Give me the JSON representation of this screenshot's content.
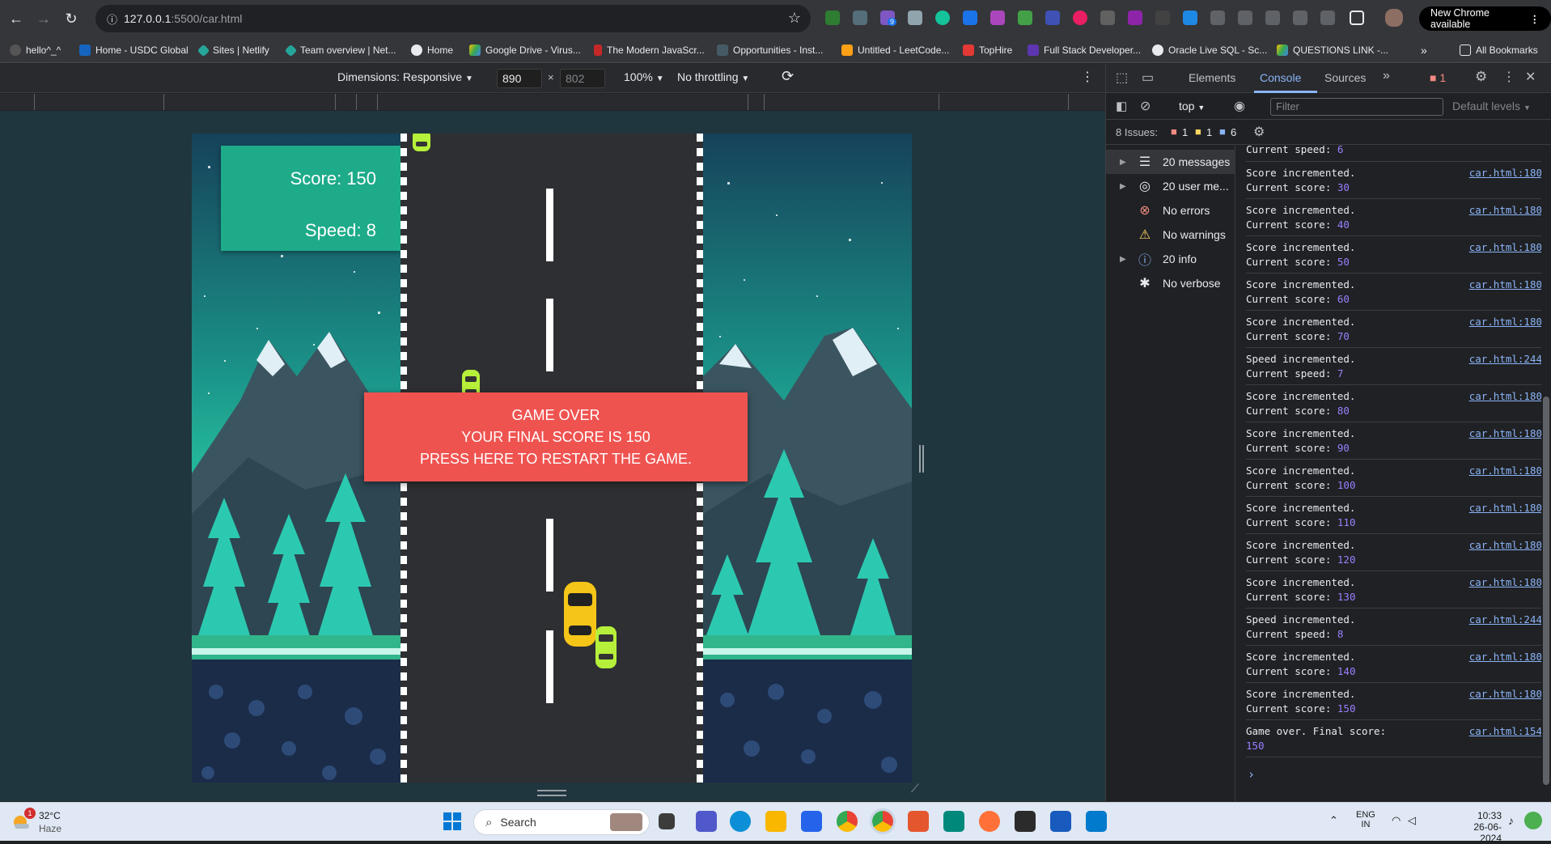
{
  "browser": {
    "url_host": "127.0.0.1",
    "url_path": ":5500/car.html",
    "new_chrome_label": "New Chrome available",
    "bookmarks": [
      "hello^_^",
      "Home - USDC Global",
      "Sites | Netlify",
      "Team overview | Net...",
      "Home",
      "Google Drive - Virus...",
      "The Modern JavaScr...",
      "Opportunities - Inst...",
      "Untitled - LeetCode...",
      "TopHire",
      "Full Stack Developer...",
      "Oracle Live SQL - Sc...",
      "QUESTIONS LINK -..."
    ],
    "all_bookmarks_label": "All Bookmarks",
    "extension_badge": "9"
  },
  "device_toolbar": {
    "dimensions_label": "Dimensions: Responsive",
    "width": "890",
    "height": "802",
    "zoom": "100%",
    "throttling": "No throttling"
  },
  "game": {
    "score_label": "Score: 150",
    "speed_label": "Speed: 8",
    "gameover_line1": "GAME OVER",
    "gameover_line2": "YOUR FINAL SCORE IS 150",
    "gameover_line3": "PRESS HERE TO RESTART THE GAME.",
    "colors": {
      "panel": "#1eab8a",
      "gameover": "#ef5350",
      "player_car": "#f5c518",
      "enemy_car": "#b6f03a"
    }
  },
  "devtools": {
    "tabs": [
      "Elements",
      "Console",
      "Sources"
    ],
    "active_tab": "Console",
    "error_count": "1",
    "context": "top",
    "filter_placeholder": "Filter",
    "levels": "Default levels",
    "issues_label": "8 Issues:",
    "issues_error": "1",
    "issues_warning": "1",
    "issues_info": "6",
    "sidebar": [
      {
        "label": "20 messages",
        "icon": "list-icon"
      },
      {
        "label": "20 user me...",
        "icon": "user-icon"
      },
      {
        "label": "No errors",
        "icon": "error-icon"
      },
      {
        "label": "No warnings",
        "icon": "warning-icon"
      },
      {
        "label": "20 info",
        "icon": "info-icon"
      },
      {
        "label": "No verbose",
        "icon": "bug-icon"
      }
    ],
    "logs": [
      {
        "l1": "Current speed: ",
        "v1": "6",
        "l2": "",
        "v2": "",
        "src": ""
      },
      {
        "l1": "Score incremented.",
        "v1": "",
        "l2": "Current score: ",
        "v2": "30",
        "src": "car.html:180"
      },
      {
        "l1": "Score incremented.",
        "v1": "",
        "l2": "Current score: ",
        "v2": "40",
        "src": "car.html:180"
      },
      {
        "l1": "Score incremented.",
        "v1": "",
        "l2": "Current score: ",
        "v2": "50",
        "src": "car.html:180"
      },
      {
        "l1": "Score incremented.",
        "v1": "",
        "l2": "Current score: ",
        "v2": "60",
        "src": "car.html:180"
      },
      {
        "l1": "Score incremented.",
        "v1": "",
        "l2": "Current score: ",
        "v2": "70",
        "src": "car.html:180"
      },
      {
        "l1": "Speed incremented.",
        "v1": "",
        "l2": "Current speed: ",
        "v2": "7",
        "src": "car.html:244"
      },
      {
        "l1": "Score incremented.",
        "v1": "",
        "l2": "Current score: ",
        "v2": "80",
        "src": "car.html:180"
      },
      {
        "l1": "Score incremented.",
        "v1": "",
        "l2": "Current score: ",
        "v2": "90",
        "src": "car.html:180"
      },
      {
        "l1": "Score incremented.",
        "v1": "",
        "l2": "Current score: ",
        "v2": "100",
        "src": "car.html:180"
      },
      {
        "l1": "Score incremented.",
        "v1": "",
        "l2": "Current score: ",
        "v2": "110",
        "src": "car.html:180"
      },
      {
        "l1": "Score incremented.",
        "v1": "",
        "l2": "Current score: ",
        "v2": "120",
        "src": "car.html:180"
      },
      {
        "l1": "Score incremented.",
        "v1": "",
        "l2": "Current score: ",
        "v2": "130",
        "src": "car.html:180"
      },
      {
        "l1": "Speed incremented.",
        "v1": "",
        "l2": "Current speed: ",
        "v2": "8",
        "src": "car.html:244"
      },
      {
        "l1": "Score incremented.",
        "v1": "",
        "l2": "Current score: ",
        "v2": "140",
        "src": "car.html:180"
      },
      {
        "l1": "Score incremented.",
        "v1": "",
        "l2": "Current score: ",
        "v2": "150",
        "src": "car.html:180"
      },
      {
        "l1": "Game over. Final score:",
        "v1": "",
        "l2": "",
        "v2": "150",
        "src": "car.html:154"
      }
    ],
    "prompt": "›"
  },
  "taskbar": {
    "weather_temp": "32°C",
    "weather_desc": "Haze",
    "weather_badge": "1",
    "search_label": "Search",
    "lang1": "ENG",
    "lang2": "IN",
    "time": "10:33",
    "date": "26-06-2024"
  }
}
